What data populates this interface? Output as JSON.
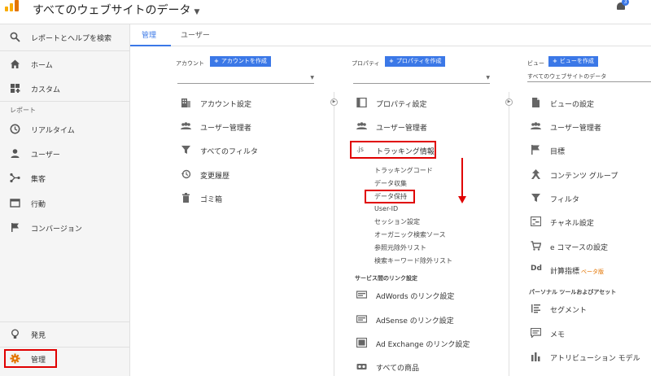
{
  "header": {
    "title": "すべてのウェブサイトのデータ",
    "notification_count": "3"
  },
  "sidebar": {
    "search_label": "レポートとヘルプを検索",
    "home_label": "ホーム",
    "custom_label": "カスタム",
    "reports_section": "レポート",
    "realtime_label": "リアルタイム",
    "user_label": "ユーザー",
    "acquisition_label": "集客",
    "behavior_label": "行動",
    "conversion_label": "コンバージョン",
    "discover_label": "発見",
    "admin_label": "管理"
  },
  "tabs": {
    "admin": "管理",
    "user": "ユーザー"
  },
  "account": {
    "header": "アカウント",
    "create_label": "アカウントを作成",
    "items": [
      "アカウント設定",
      "ユーザー管理者",
      "すべてのフィルタ",
      "変更履歴",
      "ゴミ箱"
    ]
  },
  "property": {
    "header": "プロパティ",
    "create_label": "プロパティを作成",
    "settings": "プロパティ設定",
    "user_mgmt": "ユーザー管理者",
    "tracking_icon": ".js",
    "tracking": "トラッキング情報",
    "tracking_sub": [
      "トラッキングコード",
      "データ収集",
      "データ保持",
      "User-ID",
      "セッション設定",
      "オーガニック検索ソース",
      "参照元除外リスト",
      "検索キーワード除外リスト"
    ],
    "services_group": "サービス間のリンク設定",
    "links": [
      "AdWords のリンク設定",
      "AdSense のリンク設定",
      "Ad Exchange のリンク設定",
      "すべての商品"
    ]
  },
  "view": {
    "header": "ビュー",
    "create_label": "ビューを作成",
    "selected": "すべてのウェブサイトのデータ",
    "items": [
      "ビューの設定",
      "ユーザー管理者",
      "目標",
      "コンテンツ グループ",
      "フィルタ",
      "チャネル設定",
      "e コマースの設定"
    ],
    "calc_icon": "Dd",
    "calc_label": "計算指標",
    "calc_beta": "ベータ版",
    "personal_group": "パーソナル ツールおよびアセット",
    "personal_items": [
      "セグメント",
      "メモ",
      "アトリビューション モデル"
    ]
  },
  "colors": {
    "accent": "#3b78e7",
    "highlight": "#e00000",
    "logo": "#f9ab00"
  }
}
